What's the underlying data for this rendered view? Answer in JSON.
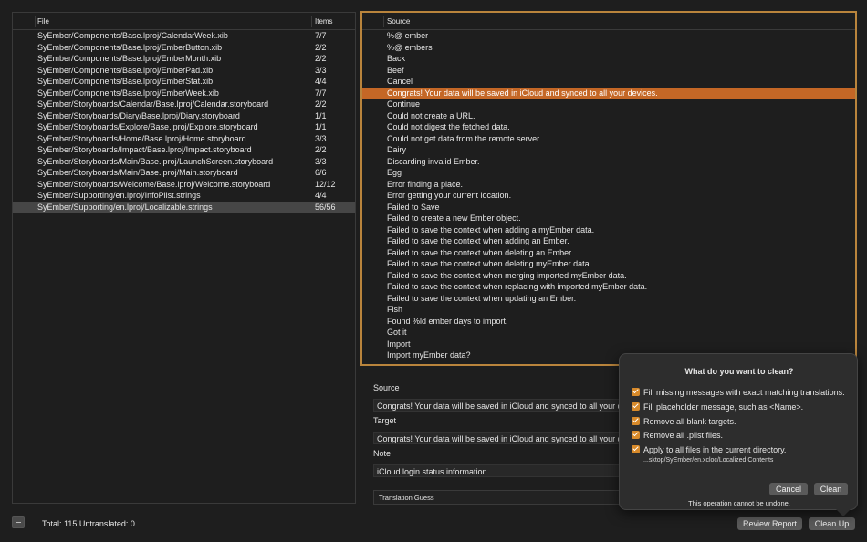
{
  "files_table": {
    "col_file": "File",
    "col_items": "Items",
    "rows": [
      {
        "path": "SyEmber/Components/Base.lproj/CalendarWeek.xib",
        "items": "7/7"
      },
      {
        "path": "SyEmber/Components/Base.lproj/EmberButton.xib",
        "items": "2/2"
      },
      {
        "path": "SyEmber/Components/Base.lproj/EmberMonth.xib",
        "items": "2/2"
      },
      {
        "path": "SyEmber/Components/Base.lproj/EmberPad.xib",
        "items": "3/3"
      },
      {
        "path": "SyEmber/Components/Base.lproj/EmberStat.xib",
        "items": "4/4"
      },
      {
        "path": "SyEmber/Components/Base.lproj/EmberWeek.xib",
        "items": "7/7"
      },
      {
        "path": "SyEmber/Storyboards/Calendar/Base.lproj/Calendar.storyboard",
        "items": "2/2"
      },
      {
        "path": "SyEmber/Storyboards/Diary/Base.lproj/Diary.storyboard",
        "items": "1/1"
      },
      {
        "path": "SyEmber/Storyboards/Explore/Base.lproj/Explore.storyboard",
        "items": "1/1"
      },
      {
        "path": "SyEmber/Storyboards/Home/Base.lproj/Home.storyboard",
        "items": "3/3"
      },
      {
        "path": "SyEmber/Storyboards/Impact/Base.lproj/Impact.storyboard",
        "items": "2/2"
      },
      {
        "path": "SyEmber/Storyboards/Main/Base.lproj/LaunchScreen.storyboard",
        "items": "3/3"
      },
      {
        "path": "SyEmber/Storyboards/Main/Base.lproj/Main.storyboard",
        "items": "6/6"
      },
      {
        "path": "SyEmber/Storyboards/Welcome/Base.lproj/Welcome.storyboard",
        "items": "12/12"
      },
      {
        "path": "SyEmber/Supporting/en.lproj/InfoPlist.strings",
        "items": "4/4"
      },
      {
        "path": "SyEmber/Supporting/en.lproj/Localizable.strings",
        "items": "56/56"
      }
    ],
    "selected_index": 15
  },
  "source_table": {
    "col_source": "Source",
    "rows": [
      "%@ ember",
      "%@ embers",
      "Back",
      "Beef",
      "Cancel",
      "Congrats! Your data will be saved in iCloud and synced to all your devices.",
      "Continue",
      "Could not create a URL.",
      "Could not digest the fetched data.",
      "Could not get data from the remote server.",
      "Dairy",
      "Discarding invalid Ember.",
      "Egg",
      "Error finding a place.",
      "Error getting your current location.",
      "Failed to Save",
      "Failed to create a new Ember object.",
      "Failed to save the context when adding a myEmber data.",
      "Failed to save the context when adding an Ember.",
      "Failed to save the context when deleting an Ember.",
      "Failed to save the context when deleting myEmber data.",
      "Failed to save the context when merging imported myEmber data.",
      "Failed to save the context when replacing with imported myEmber data.",
      "Failed to save the context when updating an Ember.",
      "Fish",
      "Found %ld ember days to import.",
      "Got it",
      "Import",
      "Import myEmber data?"
    ],
    "selected_index": 5
  },
  "detail": {
    "source_label": "Source",
    "source_value": "Congrats! Your data will be saved in iCloud and synced to all your devices.",
    "target_label": "Target",
    "target_value": "Congrats! Your data will be saved in iCloud and synced to all your devices.",
    "note_label": "Note",
    "note_value": "iCloud login status information",
    "translation_guess": "Translation Guess"
  },
  "footer": {
    "status": "Total: 115 Untranslated: 0",
    "review_report": "Review Report",
    "clean_up": "Clean Up"
  },
  "clean_popover": {
    "title": "What do you want to clean?",
    "options": [
      {
        "label": "Fill missing messages with exact matching translations.",
        "checked": true
      },
      {
        "label": "Fill placeholder message, such as <Name>.",
        "checked": true
      },
      {
        "label": "Remove all blank targets.",
        "checked": true
      },
      {
        "label": "Remove all .plist files.",
        "checked": true
      },
      {
        "label": "Apply to all files in the current directory.",
        "checked": true
      }
    ],
    "path": "...sktop/SyEmber/en.xcloc/Localized Contents",
    "cancel": "Cancel",
    "clean": "Clean",
    "note": "This operation cannot be undone."
  },
  "colors": {
    "selection_orange": "#c46726",
    "focus_ring": "#b9843c",
    "checkbox": "#d88a2a"
  }
}
